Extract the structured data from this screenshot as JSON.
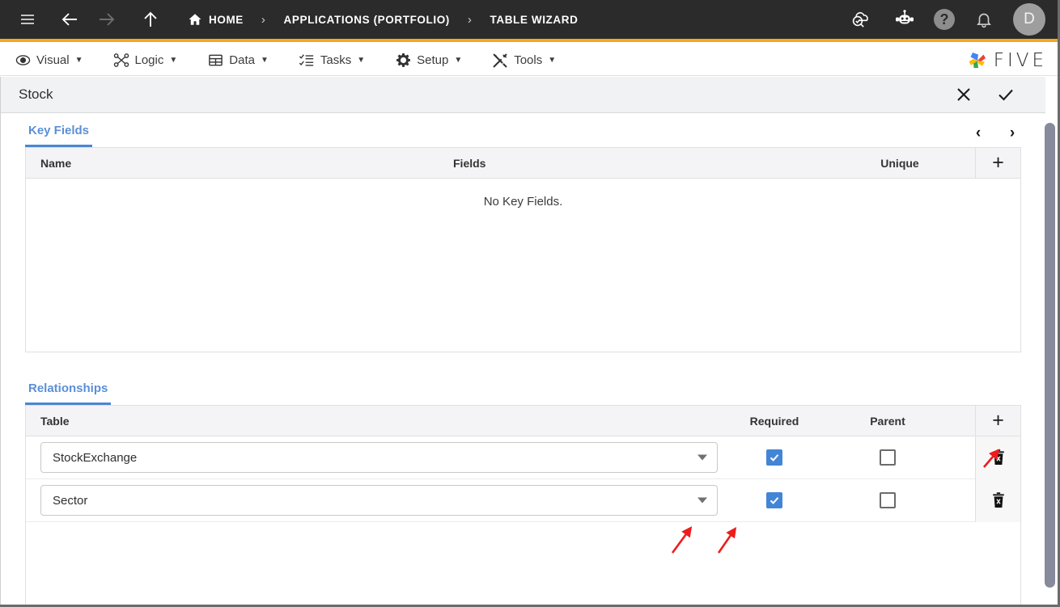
{
  "topbar": {
    "icons": {
      "menu": "hamburger-menu-icon",
      "back": "back-arrow-icon",
      "forward": "forward-arrow-icon",
      "up": "up-arrow-icon",
      "home": "home-icon",
      "cloud_check": "cloud-check-icon",
      "robot": "robot-assistant-icon",
      "help": "help-icon",
      "bell": "notification-bell-icon"
    },
    "breadcrumb": [
      {
        "label": "HOME",
        "has_home_icon": true
      },
      {
        "label": "APPLICATIONS (PORTFOLIO)",
        "has_home_icon": false
      },
      {
        "label": "TABLE WIZARD",
        "has_home_icon": false
      }
    ],
    "separator": "›",
    "help_glyph": "?",
    "avatar_initial": "D",
    "accent_color": "#f5a623",
    "background_color": "#2b2b2b"
  },
  "menubar": {
    "items": [
      {
        "label": "Visual",
        "icon": "eye-icon",
        "caret": "▼"
      },
      {
        "label": "Logic",
        "icon": "logic-nodes-icon",
        "caret": "▼"
      },
      {
        "label": "Data",
        "icon": "table-grid-icon",
        "caret": "▼"
      },
      {
        "label": "Tasks",
        "icon": "checklist-icon",
        "caret": "▼"
      },
      {
        "label": "Setup",
        "icon": "gear-icon",
        "caret": "▼"
      },
      {
        "label": "Tools",
        "icon": "tools-wrench-icon",
        "caret": "▼"
      }
    ],
    "brand": "FIVE"
  },
  "formbar": {
    "title": "Stock",
    "close_glyph": "✕",
    "confirm_glyph": "✓"
  },
  "key_fields_section": {
    "tab_label": "Key Fields",
    "prev_glyph": "‹",
    "next_glyph": "›",
    "columns": [
      "Name",
      "Fields",
      "Unique"
    ],
    "add_glyph": "+",
    "empty_message": "No Key Fields.",
    "rows": []
  },
  "relationships_section": {
    "tab_label": "Relationships",
    "columns": [
      "Table",
      "Required",
      "Parent"
    ],
    "add_glyph": "+",
    "rows": [
      {
        "table": "StockExchange",
        "required": true,
        "parent": false,
        "delete_icon": "trash-icon"
      },
      {
        "table": "Sector",
        "required": true,
        "parent": false,
        "delete_icon": "trash-icon"
      }
    ]
  },
  "annotations": {
    "arrow_color": "#ee1c1c",
    "arrows": [
      {
        "target": "relationships-add-button"
      },
      {
        "target": "sector-dropdown-caret"
      },
      {
        "target": "sector-required-checkbox"
      }
    ]
  },
  "theme": {
    "tab_accent": "#4a86d4",
    "checkbox_on": "#4285d6",
    "header_bg": "#f4f4f6"
  }
}
